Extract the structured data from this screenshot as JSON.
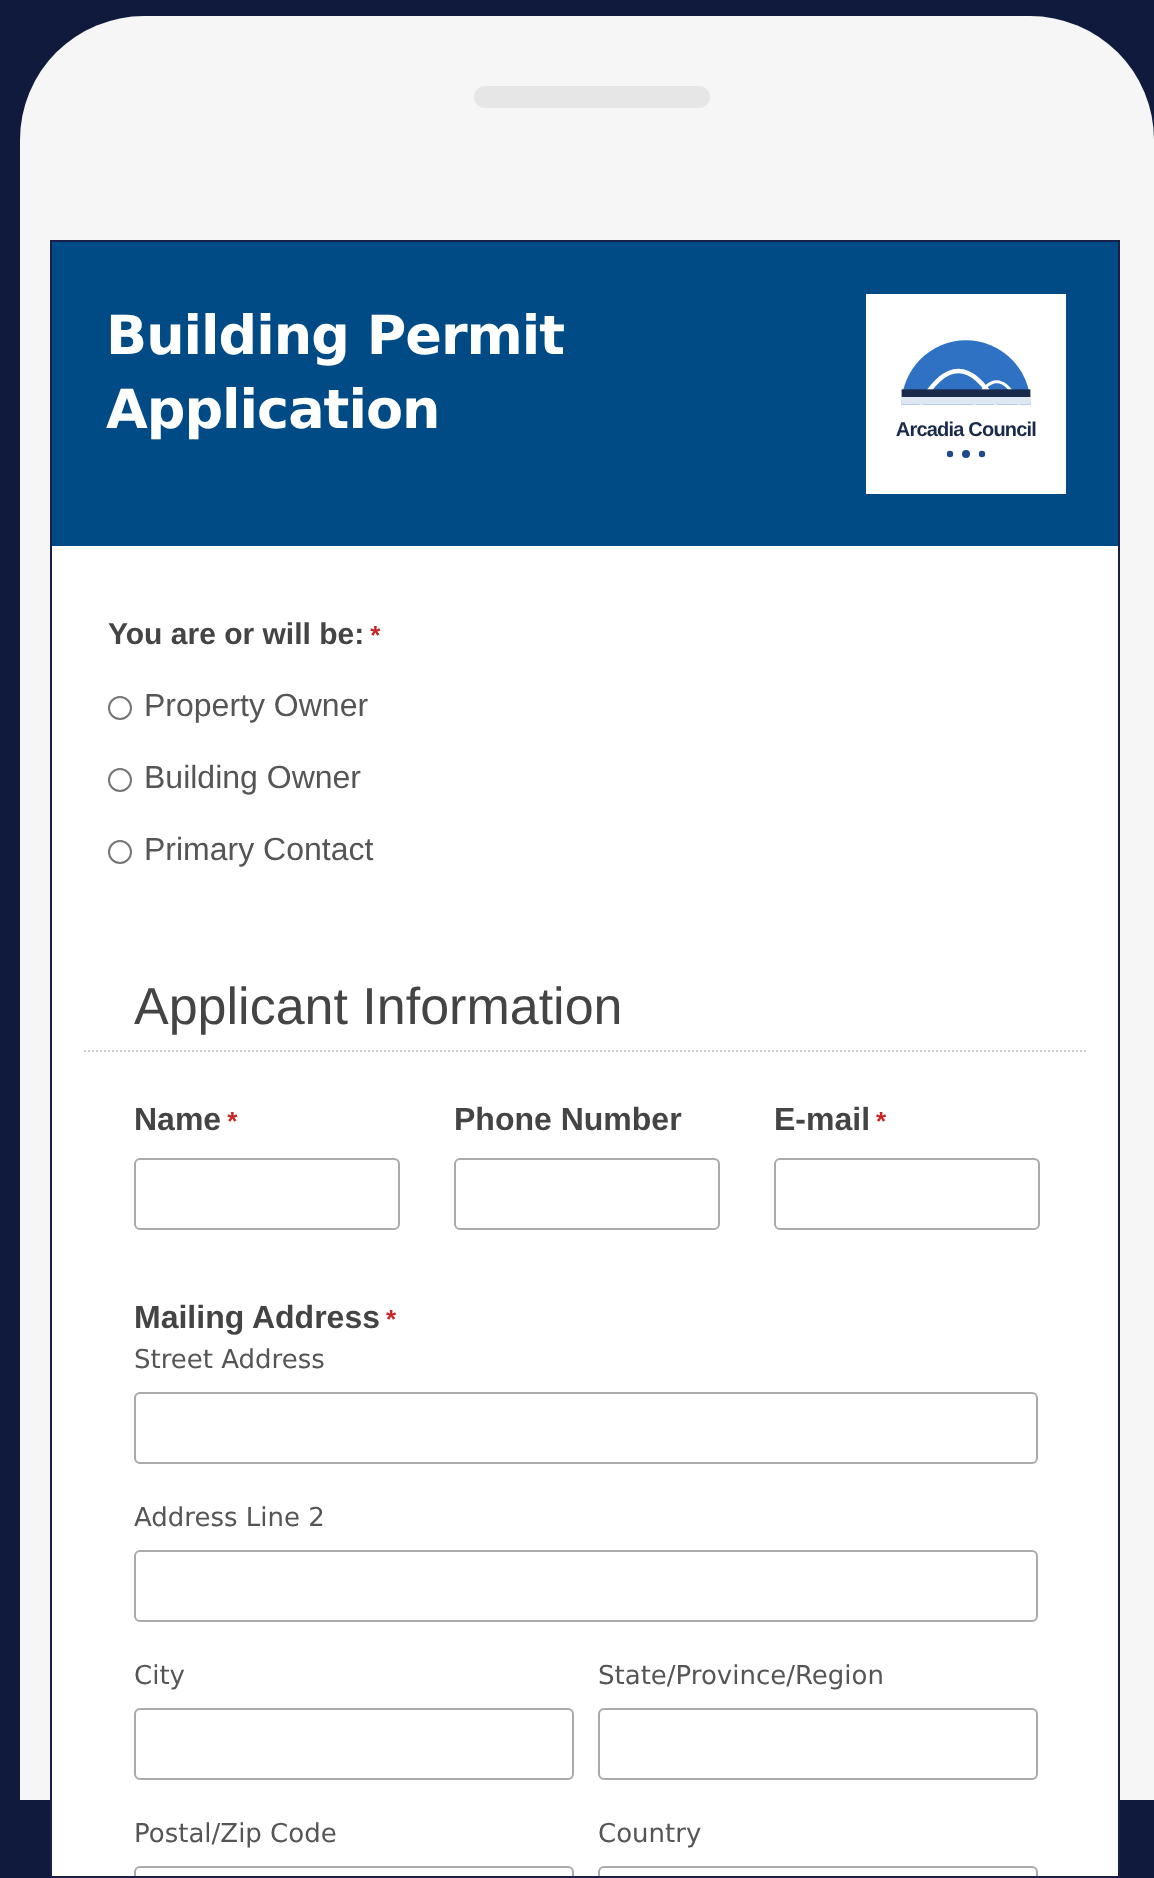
{
  "header": {
    "title": "Building Permit Application",
    "logo_text": "Arcadia Council"
  },
  "role_question": {
    "label": "You are or will be:",
    "required_mark": "*",
    "options": [
      {
        "label": "Property Owner",
        "selected": false
      },
      {
        "label": "Building Owner",
        "selected": false
      },
      {
        "label": "Primary Contact",
        "selected": false
      }
    ]
  },
  "section": {
    "title": "Applicant Information"
  },
  "contact_fields": [
    {
      "label": "Name",
      "required_mark": "*"
    },
    {
      "label": "Phone Number"
    },
    {
      "label": "E-mail",
      "required_mark": "*"
    }
  ],
  "mailing_address": {
    "label": "Mailing Address",
    "required_mark": "*",
    "fields": [
      {
        "label": "Street Address",
        "kind": "full"
      },
      {
        "label": "Address Line 2",
        "kind": "full"
      },
      {
        "label": "City",
        "kind": "half"
      },
      {
        "label": "State/Province/Region",
        "kind": "half"
      },
      {
        "label": "Postal/Zip Code",
        "kind": "half"
      },
      {
        "label": "Country",
        "kind": "half"
      }
    ]
  }
}
